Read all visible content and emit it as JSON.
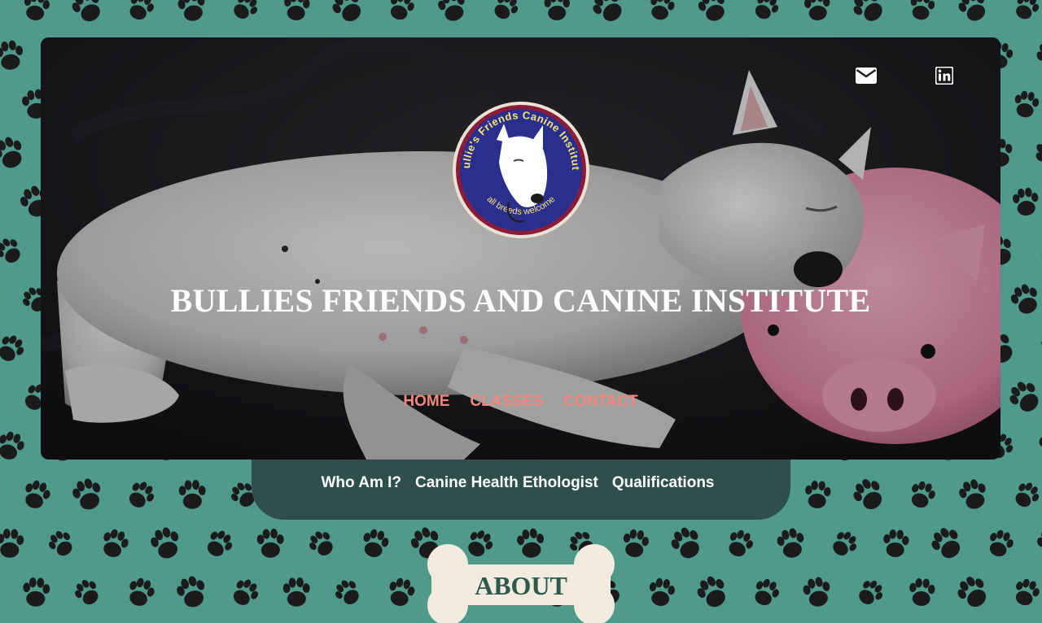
{
  "site": {
    "title": "BULLIES FRIENDS AND CANINE INSTITUTE"
  },
  "logo": {
    "top_text": "Bullie's Friends Canine Institute",
    "bottom_text": "all breeds welcome",
    "icon": "bull-terrier-icon"
  },
  "social": [
    {
      "name": "email",
      "icon": "envelope-icon"
    },
    {
      "name": "linkedin",
      "icon": "linkedin-icon"
    }
  ],
  "main_nav": [
    {
      "label": "HOME"
    },
    {
      "label": "CLASSES"
    },
    {
      "label": "CONTACT"
    }
  ],
  "sub_nav": [
    {
      "label": "Who Am I?"
    },
    {
      "label": "Canine Health Ethologist"
    },
    {
      "label": "Qualifications"
    }
  ],
  "section": {
    "heading": "ABOUT"
  },
  "colors": {
    "background": "#4f9a8a",
    "paw_prints": "#1b1b1b",
    "nav_link": "#f0877c",
    "sub_nav_bg": "#2f4f4d",
    "bone": "#f3ebe0",
    "heading": "#2c5a4e",
    "logo_blue": "#2b2f8c",
    "logo_ring": "#8c1b3a"
  }
}
